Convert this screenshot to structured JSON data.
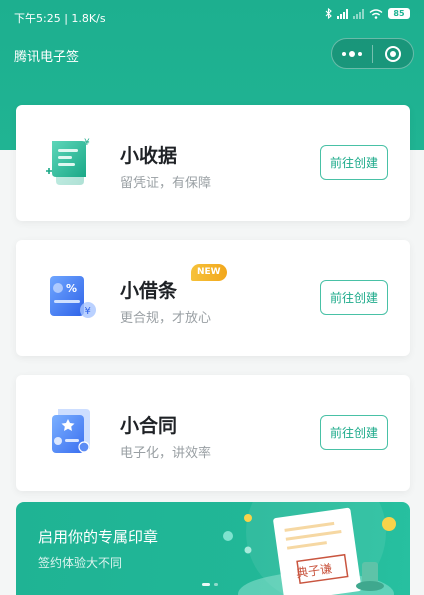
{
  "status_bar": {
    "time": "下午5:25 | 1.8K/s",
    "battery": "85"
  },
  "nav": {
    "title": "腾讯电子签"
  },
  "cards": [
    {
      "title": "小收据",
      "subtitle": "留凭证，有保障",
      "button": "前往创建",
      "icon": "receipt-icon"
    },
    {
      "title": "小借条",
      "subtitle": "更合规，才放心",
      "button": "前往创建",
      "badge": "NEW",
      "icon": "iou-icon"
    },
    {
      "title": "小合同",
      "subtitle": "电子化，讲效率",
      "button": "前往创建",
      "icon": "contract-icon"
    }
  ],
  "banner": {
    "title": "启用你的专属印章",
    "subtitle": "签约体验大不同",
    "seal_text": "典子谦",
    "carousel_pages": 2
  },
  "colors": {
    "brand": "#20b493",
    "badge": "#f2a71c",
    "button_border": "#49c1a6"
  }
}
